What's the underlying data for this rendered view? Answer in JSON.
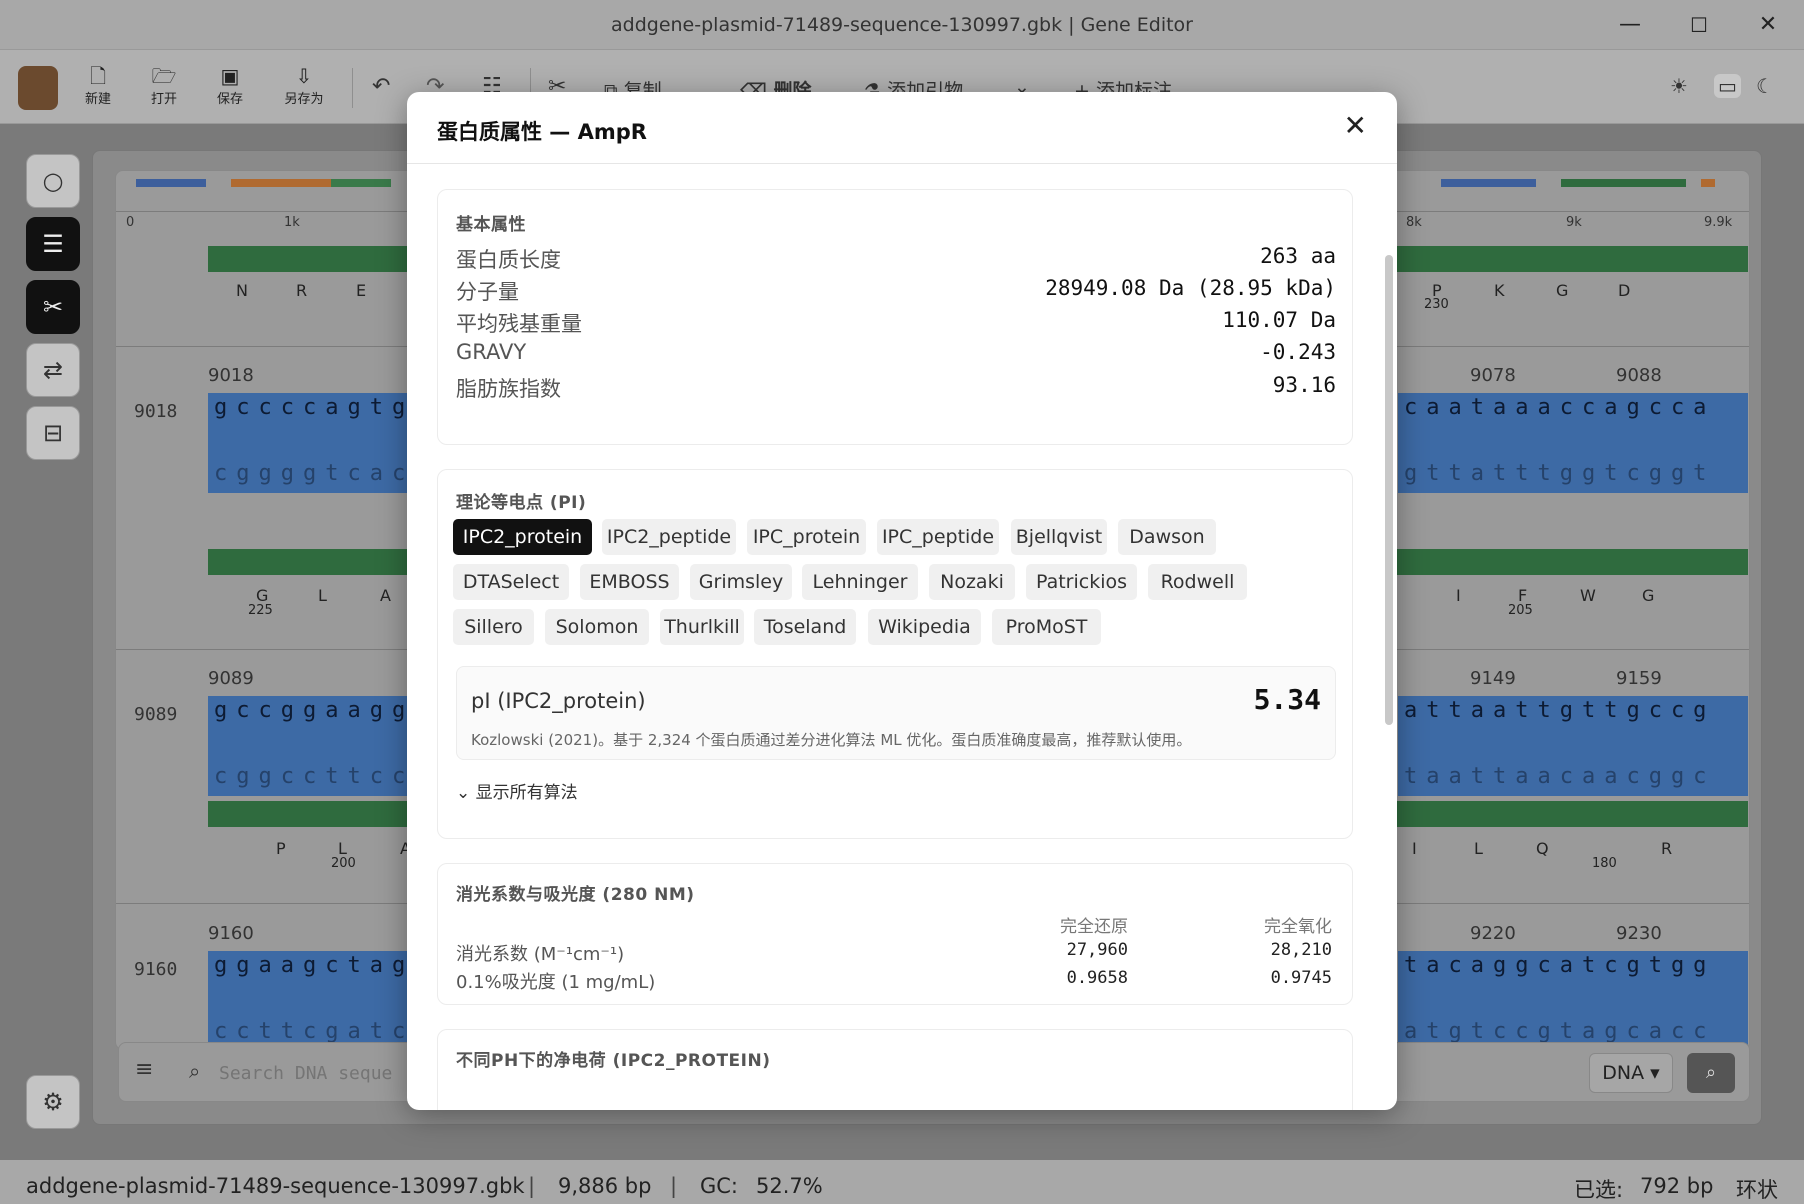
{
  "window": {
    "title": "addgene-plasmid-71489-sequence-130997.gbk | Gene Editor"
  },
  "toolbar": {
    "new": "新建",
    "open": "打开",
    "save": "保存",
    "saveas": "另存为",
    "copy": "复制",
    "delete": "删除",
    "add_primer": "添加引物",
    "add_annotation": "添加标注"
  },
  "map": {
    "ticks": [
      "0",
      "1k",
      "8k",
      "9k",
      "9.9k"
    ]
  },
  "seq": {
    "r1": {
      "aa_left": [
        "N",
        "R",
        "E"
      ],
      "aa_right": [
        "P",
        "K",
        "G",
        "D"
      ],
      "num_right": "230"
    },
    "r2": {
      "pos": "9018",
      "start": "9018",
      "end_a": "9078",
      "end_b": "9088",
      "top_left": "gccccagtgc",
      "bot_left": "cggggtcacg",
      "top_right": "caataaaccagcca",
      "bot_right": "gttatttggtcggt",
      "aa_left": [
        "G",
        "L",
        "A"
      ],
      "num_left": "225",
      "aa_right": [
        "I",
        "F",
        "W",
        "G"
      ],
      "num_right": "205"
    },
    "r3": {
      "pos": "9089",
      "start": "9089",
      "end_a": "9149",
      "end_b": "9159",
      "top_left": "gccggaaggg",
      "bot_left": "cggccttccc",
      "top_right": "attaattgttgccg",
      "bot_right": "taattaacaacggc",
      "aa_left": [
        "P",
        "L",
        "A"
      ],
      "num_left": "200",
      "aa_right": [
        "I",
        "L",
        "Q",
        "R"
      ],
      "num_right": "180"
    },
    "r4": {
      "pos": "9160",
      "start": "9160",
      "end_a": "9220",
      "end_b": "9230",
      "top_left": "ggaagctaga",
      "bot_left": "ccttcgatct",
      "top_right": "tacaggcatcgtgg",
      "bot_right": "atgtccgtagcacc"
    }
  },
  "search": {
    "placeholder": "Search DNA seque",
    "mode": "DNA ▾"
  },
  "status": {
    "file": "addgene-plasmid-71489-sequence-130997.gbk",
    "length": "9,886 bp",
    "gc_label": "GC:",
    "gc": "52.7%",
    "sel_label": "已选:",
    "sel": "792 bp",
    "topology": "环状"
  },
  "modal": {
    "title": "蛋白质属性 — AmpR",
    "basic": {
      "heading": "基本属性",
      "rows": [
        {
          "k": "蛋白质长度",
          "v": "263 aa"
        },
        {
          "k": "分子量",
          "v": "28949.08 Da (28.95 kDa)"
        },
        {
          "k": "平均残基重量",
          "v": "110.07 Da"
        },
        {
          "k": "GRAVY",
          "v": "-0.243"
        },
        {
          "k": "脂肪族指数",
          "v": "93.16"
        }
      ]
    },
    "pi": {
      "heading": "理论等电点 (PI)",
      "chips": [
        "IPC2_protein",
        "IPC2_peptide",
        "IPC_protein",
        "IPC_peptide",
        "Bjellqvist",
        "Dawson",
        "DTASelect",
        "EMBOSS",
        "Grimsley",
        "Lehninger",
        "Nozaki",
        "Patrickios",
        "Rodwell",
        "Sillero",
        "Solomon",
        "Thurlkill",
        "Toseland",
        "Wikipedia",
        "ProMoST"
      ],
      "selected": "IPC2_protein",
      "result_label": "pI (IPC2_protein)",
      "result_value": "5.34",
      "note": "Kozlowski (2021)。基于 2,324 个蛋白质通过差分进化算法 ML 优化。蛋白质准确度最高，推荐默认使用。",
      "toggle": "显示所有算法"
    },
    "ext": {
      "heading": "消光系数与吸光度 (280 NM)",
      "col_reduced": "完全还原",
      "col_oxidized": "完全氧化",
      "rows": [
        {
          "k": "消光系数 (M⁻¹cm⁻¹)",
          "a": "27,960",
          "b": "28,210"
        },
        {
          "k": "0.1%吸光度 (1 mg/mL)",
          "a": "0.9658",
          "b": "0.9745"
        }
      ]
    },
    "charge": {
      "heading": "不同PH下的净电荷 (IPC2_PROTEIN)"
    }
  }
}
